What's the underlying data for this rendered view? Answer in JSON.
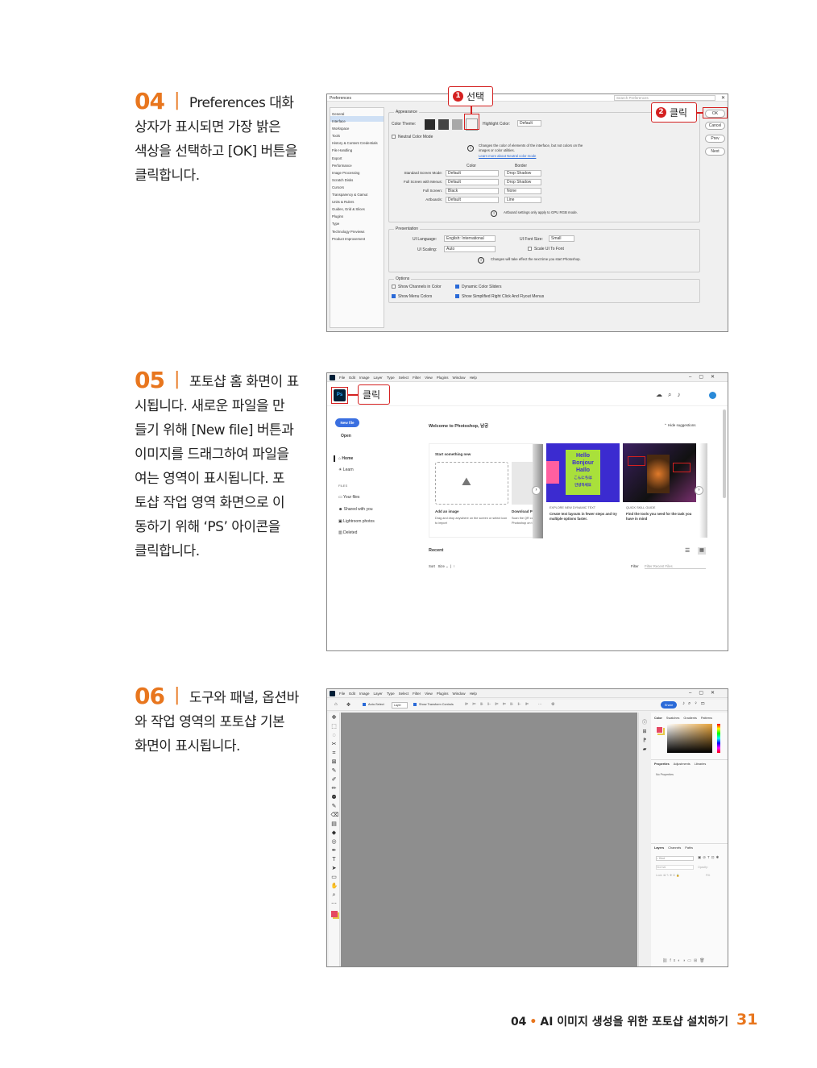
{
  "steps": [
    {
      "num": "04",
      "text_first": "Preferences 대화",
      "lines": [
        "상자가 표시되면 가장 밝은",
        "색상을 선택하고 [OK] 버튼을",
        "클릭합니다."
      ]
    },
    {
      "num": "05",
      "text_first": "포토샵 홈 화면이 표",
      "lines": [
        "시됩니다. 새로운 파일을 만",
        "들기 위해 [New file] 버튼과",
        "이미지를 드래그하여 파일을",
        "여는 영역이 표시됩니다. 포",
        "토샵 작업 영역 화면으로 이",
        "동하기 위해 ‘PS’ 아이콘을",
        "클릭합니다."
      ]
    },
    {
      "num": "06",
      "text_first": "도구와 패널, 옵션바",
      "lines": [
        "와 작업 영역의 포토샵 기본",
        "화면이 표시됩니다."
      ]
    }
  ],
  "callouts": {
    "select": {
      "n": "1",
      "label": "선택"
    },
    "click_ok": {
      "n": "2",
      "label": "클릭"
    },
    "click_ps": {
      "label": "클릭"
    }
  },
  "prefs": {
    "title": "Preferences",
    "search_placeholder": "Search Preferences",
    "close": "✕",
    "sidebar": [
      "General",
      "Interface",
      "Workspace",
      "Tools",
      "History & Content Credentials",
      "File Handling",
      "Export",
      "Performance",
      "Image Processing",
      "Scratch Disks",
      "Cursors",
      "Transparency & Gamut",
      "Units & Rulers",
      "Guides, Grid & Slices",
      "Plugins",
      "Type",
      "Technology Previews",
      "Product Improvement"
    ],
    "buttons": {
      "ok": "OK",
      "cancel": "Cancel",
      "prev": "Prev",
      "next": "Next"
    },
    "appearance": "Appearance",
    "color_theme": "Color Theme:",
    "highlight_color": "Highlight Color:",
    "highlight_value": "Default",
    "neutral": "Neutral Color Mode",
    "neutral_info": "Changes the color of elements of the interface, but not colors on the",
    "neutral_info2": "images or color utilities.",
    "neutral_link": "Learn more about Neutral color mode",
    "col_color": "Color",
    "col_border": "Border",
    "rows": [
      {
        "label": "Standard Screen Mode:",
        "color": "Default",
        "border": "Drop Shadow"
      },
      {
        "label": "Full Screen with Menus:",
        "color": "Default",
        "border": "Drop Shadow"
      },
      {
        "label": "Full Screen:",
        "color": "Black",
        "border": "None"
      },
      {
        "label": "Artboards:",
        "color": "Default",
        "border": "Line"
      }
    ],
    "artboard_info": "Artboard settings only apply to GPU RGB mode.",
    "presentation": "Presentation",
    "ui_language": "UI Language:",
    "ui_language_value": "English: International",
    "ui_font_size": "UI Font Size:",
    "ui_font_size_value": "Small",
    "ui_scaling": "UI Scaling:",
    "ui_scaling_value": "Auto",
    "scale_ui_font": "Scale UI To Font",
    "pres_info": "Changes will take effect the next time you start Photoshop.",
    "options": "Options",
    "opt1": "Show Channels in Color",
    "opt2": "Dynamic Color Sliders",
    "opt3": "Show Menu Colors",
    "opt4": "Show Simplified Right Click And Flyout Menus"
  },
  "menu": [
    "File",
    "Edit",
    "Image",
    "Layer",
    "Type",
    "Select",
    "Filter",
    "View",
    "Plugins",
    "Window",
    "Help"
  ],
  "home": {
    "ps": "Ps",
    "new_file": "New file",
    "open": "Open",
    "nav_home": "Home",
    "nav_learn": "Learn",
    "files_header": "FILES",
    "your_files": "Your files",
    "shared": "Shared with you",
    "lightroom": "Lightroom photos",
    "deleted": "Deleted",
    "welcome": "Welcome to Photoshop, 남궁",
    "hide": "Hide suggestions",
    "start_new": "Start something new",
    "add_image": "Add an image",
    "add_image_desc": "Drag and drop anywhere on the screen or select icon to import",
    "download": "Download Pl",
    "download_desc": "Scan the QR co Photoshop on t",
    "card2_tag": "EXPLORE NEW DYNAMIC TEXT",
    "card2_title": "Create text layouts in fewer steps and try multiple options faster.",
    "card2_art": [
      "Hello",
      "Bonjour",
      "Hallo",
      "こんにちは",
      "안녕하세요"
    ],
    "card3_tag": "QUICK SKILL GUIDE",
    "card3_title": "Find the tools you need for the task you have in mind",
    "recent": "Recent",
    "sort": "Sort",
    "sort_val": "Size",
    "filter": "Filter",
    "filter_placeholder": "Filter Recent Files"
  },
  "workspace": {
    "auto_select": "Auto-Select",
    "layer": "Layer",
    "transform": "Show Transform Controls",
    "share": "Share",
    "color_tabs": [
      "Color",
      "Swatches",
      "Gradients",
      "Patterns"
    ],
    "prop_tabs": [
      "Properties",
      "Adjustments",
      "Libraries"
    ],
    "no_props": "No Properties",
    "layer_tabs": [
      "Layers",
      "Channels",
      "Paths"
    ],
    "kind": "Kind",
    "normal": "Normal",
    "opacity": "Opacity:",
    "lock": "Lock:",
    "fill": "Fill:"
  },
  "footer": {
    "chapter": "04",
    "dot": "•",
    "title": "AI 이미지 생성을 위한 포토샵 설치하기",
    "page": "31"
  },
  "colors": {
    "accent": "#e8761e",
    "callout": "#d42020",
    "ps_blue": "#2a6ad8"
  }
}
